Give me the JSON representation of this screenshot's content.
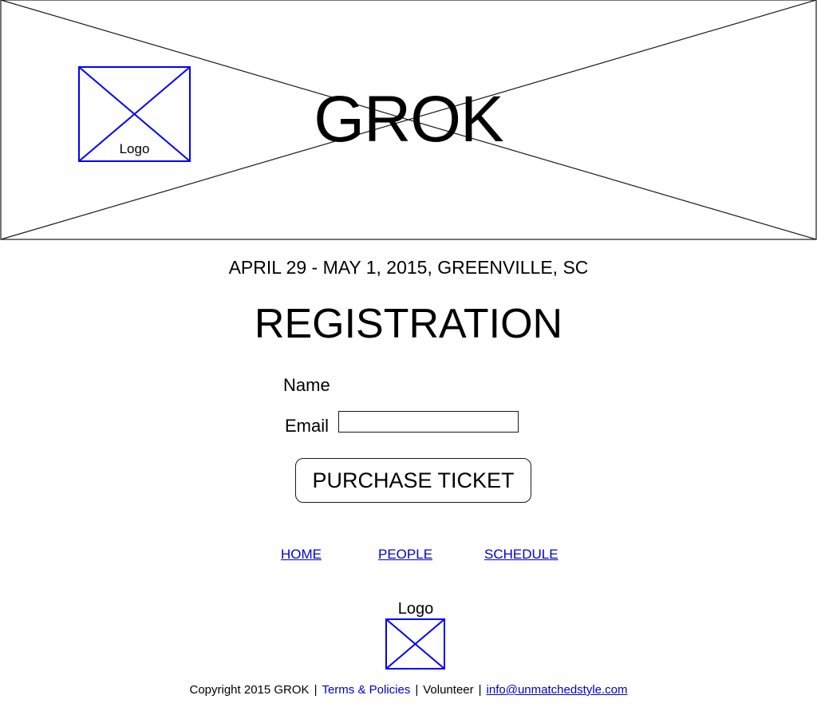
{
  "colors": {
    "link": "#0000cc",
    "placeholder_box": "#0000ff",
    "line": "#1a1a1a"
  },
  "header": {
    "title": "GROK",
    "logo_label": "Logo",
    "image_placeholder": "crossed-box-icon"
  },
  "event": {
    "date_location": "APRIL 29 - MAY 1, 2015, GREENVILLE, SC"
  },
  "registration": {
    "title": "REGISTRATION",
    "name_label": "Name",
    "email_label": "Email",
    "email_value": "",
    "purchase_label": "PURCHASE TICKET"
  },
  "nav": {
    "items": [
      {
        "label": "HOME"
      },
      {
        "label": "PEOPLE"
      },
      {
        "label": "SCHEDULE"
      }
    ]
  },
  "footer": {
    "logo_label": "Logo",
    "copyright": "Copyright 2015 GROK",
    "separator": "|",
    "terms": "Terms & Policies",
    "volunteer": "Volunteer",
    "email": "info@unmatchedstyle.com"
  }
}
